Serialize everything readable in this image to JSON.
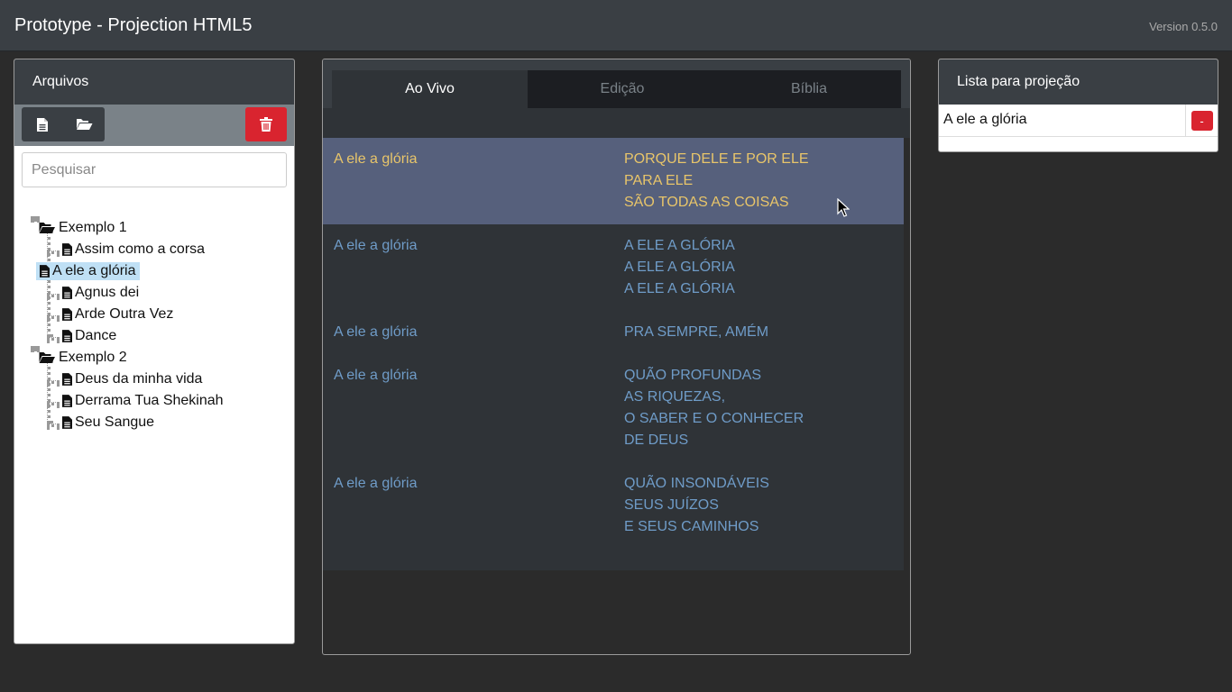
{
  "header": {
    "title": "Prototype - Projection HTML5",
    "version": "Version 0.5.0"
  },
  "files_panel": {
    "title": "Arquivos",
    "toolbar": {
      "new_icon": "file-icon",
      "open_icon": "folder-open-icon",
      "delete_icon": "trash-icon"
    },
    "search_placeholder": "Pesquisar",
    "tree": [
      {
        "folder": "Exemplo 1",
        "files": [
          "Assim como a corsa",
          "A ele a glória",
          "Agnus dei",
          "Arde Outra Vez",
          "Dance"
        ]
      },
      {
        "folder": "Exemplo 2",
        "files": [
          "Deus da minha vida",
          "Derrama Tua Shekinah",
          "Seu Sangue"
        ]
      }
    ],
    "selected_file": "A ele a glória"
  },
  "center": {
    "tabs": [
      {
        "label": "Ao Vivo",
        "active": true
      },
      {
        "label": "Edição",
        "active": false
      },
      {
        "label": "Bíblia",
        "active": false
      }
    ],
    "slides": [
      {
        "title": "A ele a glória",
        "lines": [
          "PORQUE DELE E POR ELE",
          "PARA ELE",
          "SÃO TODAS AS COISAS"
        ],
        "active": true
      },
      {
        "title": "A ele a glória",
        "lines": [
          "A ELE A GLÓRIA",
          "A ELE A GLÓRIA",
          "A ELE A GLÓRIA"
        ],
        "active": false
      },
      {
        "title": "A ele a glória",
        "lines": [
          "PRA SEMPRE, AMÉM"
        ],
        "active": false
      },
      {
        "title": "A ele a glória",
        "lines": [
          "QUÃO PROFUNDAS",
          "AS RIQUEZAS,",
          "O SABER E O CONHECER",
          "DE DEUS"
        ],
        "active": false
      },
      {
        "title": "A ele a glória",
        "lines": [
          "QUÃO INSONDÁVEIS",
          "SEUS JUÍZOS",
          "E SEUS CAMINHOS"
        ],
        "active": false
      }
    ]
  },
  "projection_panel": {
    "title": "Lista para projeção",
    "items": [
      {
        "name": "A ele a glória",
        "remove_label": "-"
      }
    ]
  },
  "colors": {
    "topbar": "#3a3f44",
    "active_slide_bg": "#56607c",
    "active_slide_text": "#e8c56a",
    "slide_text": "#6f9cc8",
    "danger": "#d9242f",
    "selected_tree_item": "#bfe0f5"
  }
}
